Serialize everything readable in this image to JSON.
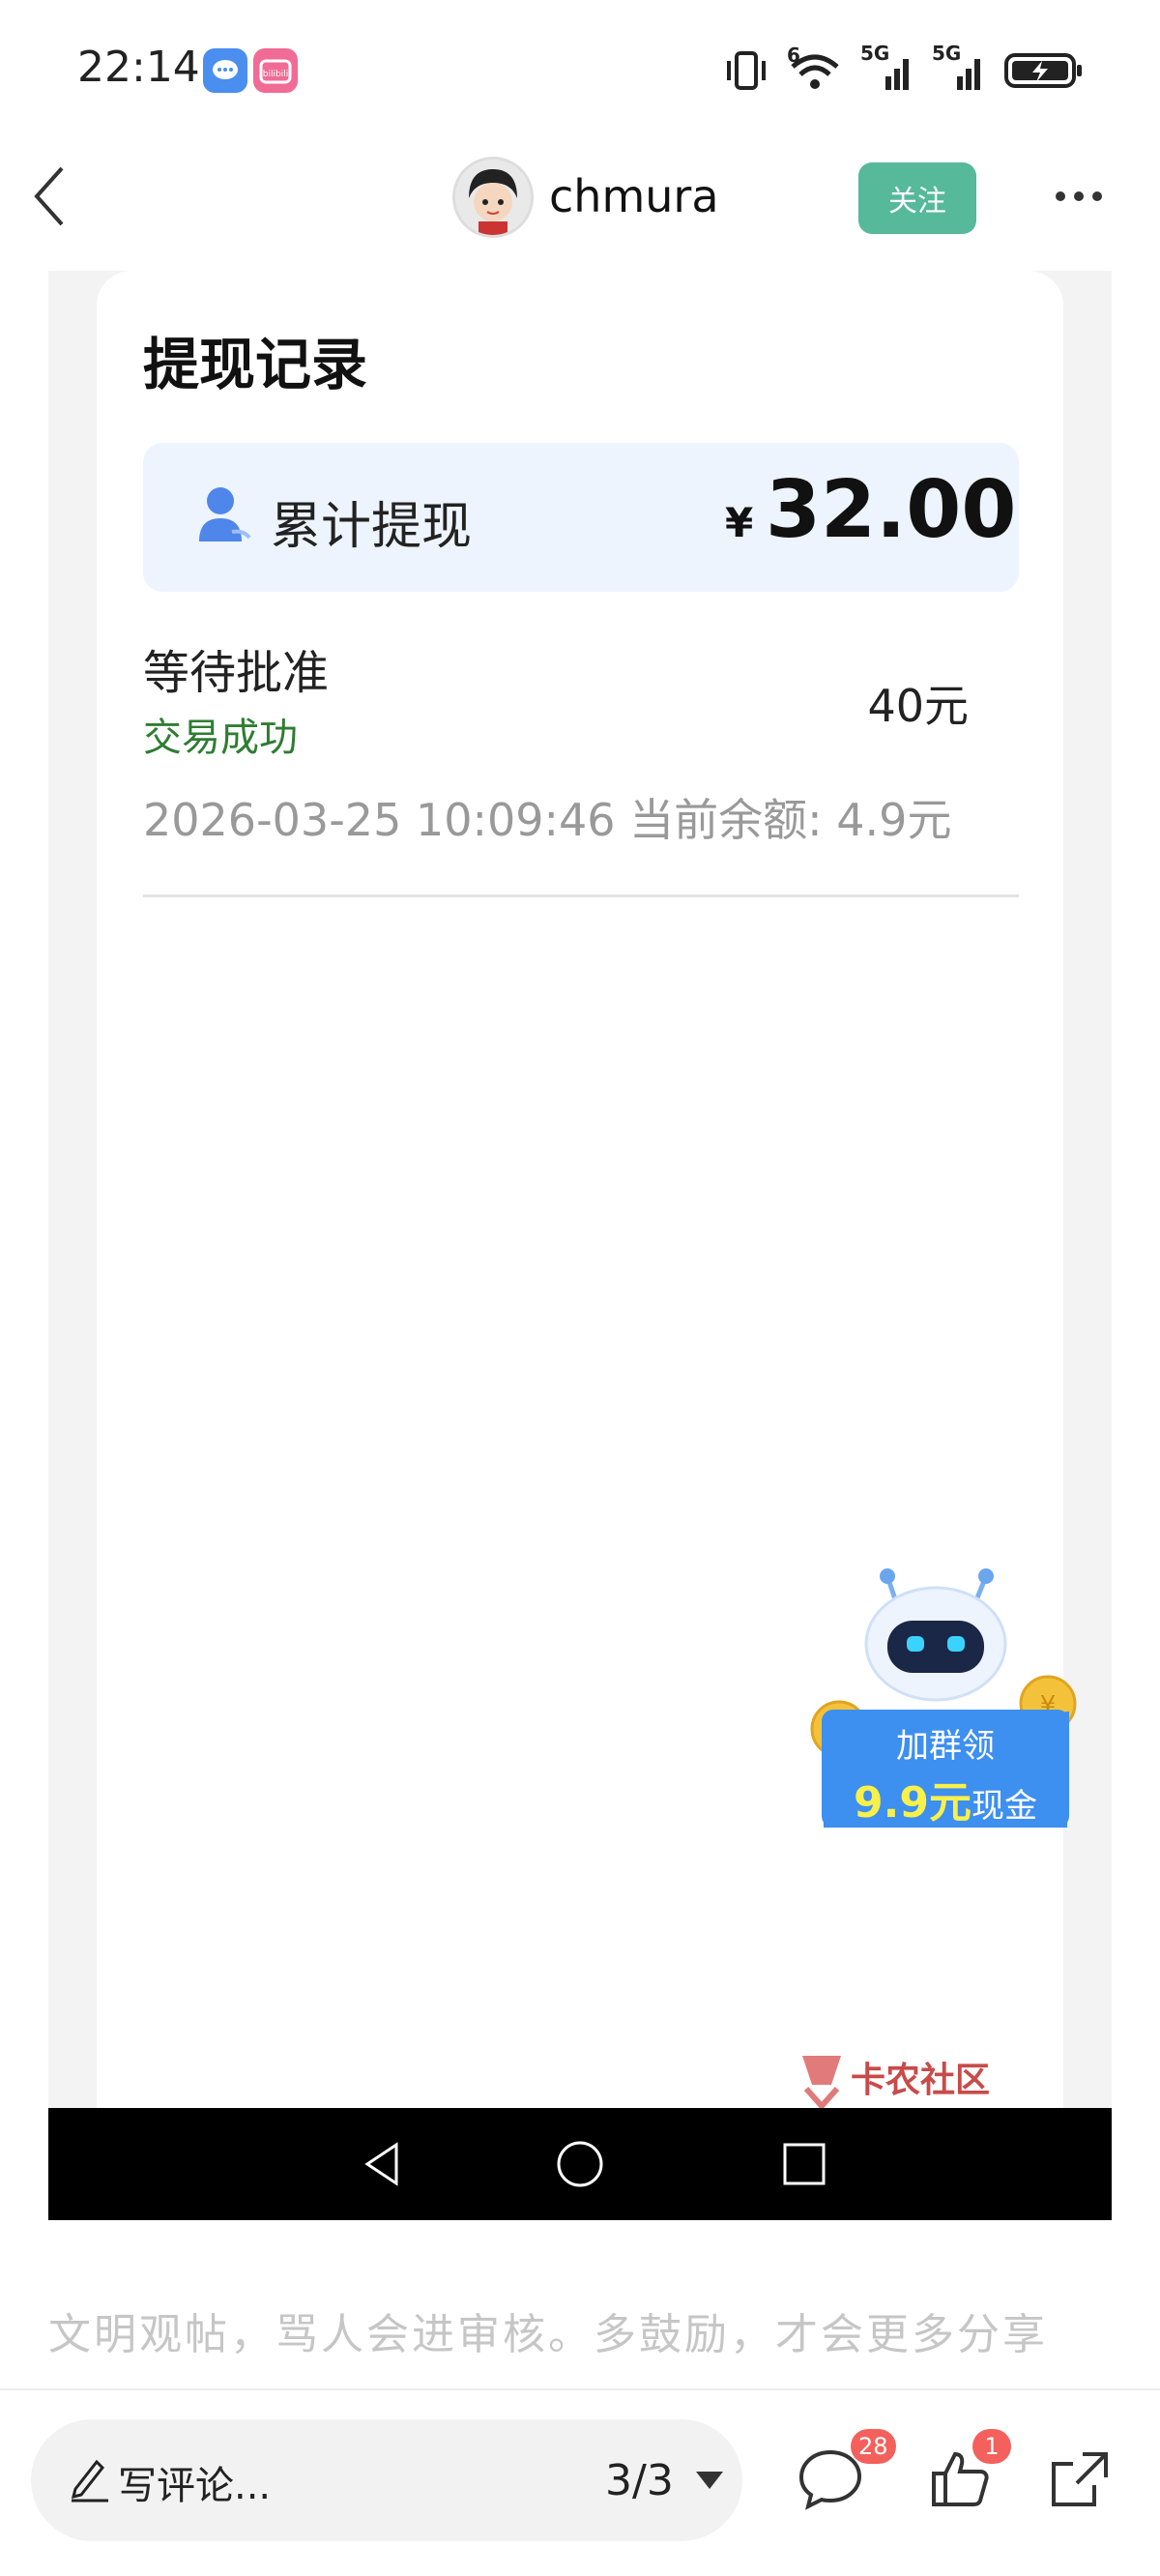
{
  "status_bar": {
    "time": "22:14",
    "apps": [
      "chat-app-icon",
      "bilibili-app-icon"
    ],
    "app_badge_text": "bilibili",
    "icons": [
      "vibrate-icon",
      "wifi-6-icon",
      "signal-5g-1-icon",
      "signal-5g-2-icon",
      "battery-charging-icon"
    ],
    "net1": "5G",
    "net2": "5G",
    "wifi_label": "6"
  },
  "header": {
    "username": "chmura",
    "follow_label": "关注"
  },
  "post_image": {
    "title": "提现记录",
    "summary": {
      "label": "累计提现",
      "currency": "¥",
      "amount": "32.00"
    },
    "record": {
      "status": "等待批准",
      "substatus": "交易成功",
      "amount": "40元",
      "meta": "2026-03-25 10:09:46 当前余额:  4.9元"
    },
    "promo": {
      "line1": "加群领",
      "highlight": "9.9元",
      "suffix": "现金"
    },
    "watermark": "卡农社区"
  },
  "comment_hint": "文明观帖，骂人会进审核。多鼓励，才会更多分享",
  "bottom_bar": {
    "comment_placeholder": "写评论...",
    "page_indicator": "3/3",
    "comment_count": "28",
    "like_count": "1"
  },
  "colors": {
    "follow_bg": "#55b99a",
    "success_green": "#2e7d32",
    "badge_red": "#f4605b",
    "summary_bg": "#edf4fd"
  }
}
